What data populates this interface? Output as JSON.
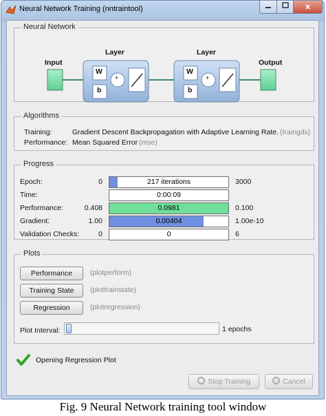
{
  "window": {
    "title": "Neural Network Training (nntraintool)",
    "close_glyph": "x"
  },
  "network": {
    "section_title": "Neural Network",
    "input_label": "Input",
    "output_label": "Output",
    "layer1_label": "Layer",
    "layer2_label": "Layer",
    "weight_label": "W",
    "bias_label": "b",
    "sum_label": "+"
  },
  "algorithms": {
    "section_title": "Algorithms",
    "training_label": "Training:",
    "training_value": "Gradient Descent Backpropagation with Adaptive Learning Rate.",
    "training_fn": "(traingdx)",
    "performance_label": "Performance:",
    "performance_value": "Mean Squared Error",
    "performance_fn": "(mse)"
  },
  "progress": {
    "section_title": "Progress",
    "rows": [
      {
        "label": "Epoch:",
        "start": "0",
        "text": "217 iterations",
        "end": "3000",
        "fill": 0.072,
        "color": "#6f8fe0"
      },
      {
        "label": "Time:",
        "start": "",
        "text": "0:00:09",
        "end": "",
        "fill": 0,
        "color": "#ffffff"
      },
      {
        "label": "Performance:",
        "start": "0.408",
        "text": "0.0981",
        "end": "0.100",
        "fill": 1.0,
        "color": "#6fdf9a"
      },
      {
        "label": "Gradient:",
        "start": "1.00",
        "text": "0.00404",
        "end": "1.00e-10",
        "fill": 0.79,
        "color": "#6f8fe0"
      },
      {
        "label": "Validation Checks:",
        "start": "0",
        "text": "0",
        "end": "6",
        "fill": 0,
        "color": "#ffffff"
      }
    ]
  },
  "plots": {
    "section_title": "Plots",
    "buttons": [
      {
        "label": "Performance",
        "fn": "(plotperform)"
      },
      {
        "label": "Training State",
        "fn": "(plottrainstate)"
      },
      {
        "label": "Regression",
        "fn": "(plotregression)"
      }
    ],
    "interval_label": "Plot Interval:",
    "interval_value": "1 epochs",
    "interval_fraction": 0.0
  },
  "status": {
    "message": "Opening Regression Plot",
    "icon": "checkmark-icon",
    "color": "#2aa52a"
  },
  "actions": {
    "stop_label": "Stop Training",
    "cancel_label": "Cancel"
  },
  "caption": "Fig. 9 Neural Network training tool window"
}
